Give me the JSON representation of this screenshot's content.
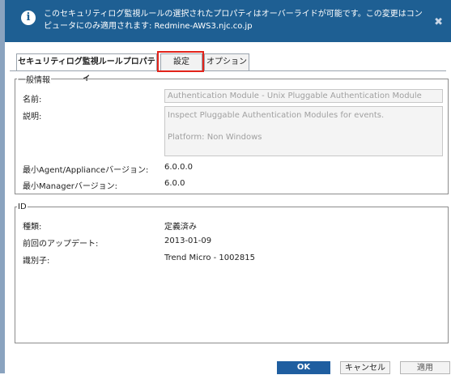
{
  "banner": {
    "text": "このセキュリティログ監視ルールの選択されたプロパティはオーバーライドが可能です。この変更はコンピュータにのみ適用されます: Redmine-AWS3.njc.co.jp"
  },
  "tabs": [
    {
      "label": "セキュリティログ監視ルールプロパティ",
      "active": true
    },
    {
      "label": "設定",
      "active": false
    },
    {
      "label": "オプション",
      "active": false
    }
  ],
  "general": {
    "legend": "一般情報",
    "name_label": "名前:",
    "name_value": "Authentication Module - Unix Pluggable Authentication Module",
    "description_label": "説明:",
    "description_line1": "Inspect Pluggable Authentication Modules for events.",
    "description_line2": "Platform: Non Windows",
    "min_agent_label": "最小Agent/Applianceバージョン:",
    "min_agent_value": "6.0.0.0",
    "min_manager_label": "最小Managerバージョン:",
    "min_manager_value": "6.0.0"
  },
  "id": {
    "legend": "ID",
    "type_label": "種類:",
    "type_value": "定義済み",
    "updated_label": "前回のアップデート:",
    "updated_value": "2013-01-09",
    "identifier_label": "識別子:",
    "identifier_value": "Trend Micro - 1002815"
  },
  "buttons": {
    "ok": "OK",
    "cancel": "キャンセル",
    "apply": "適用"
  }
}
